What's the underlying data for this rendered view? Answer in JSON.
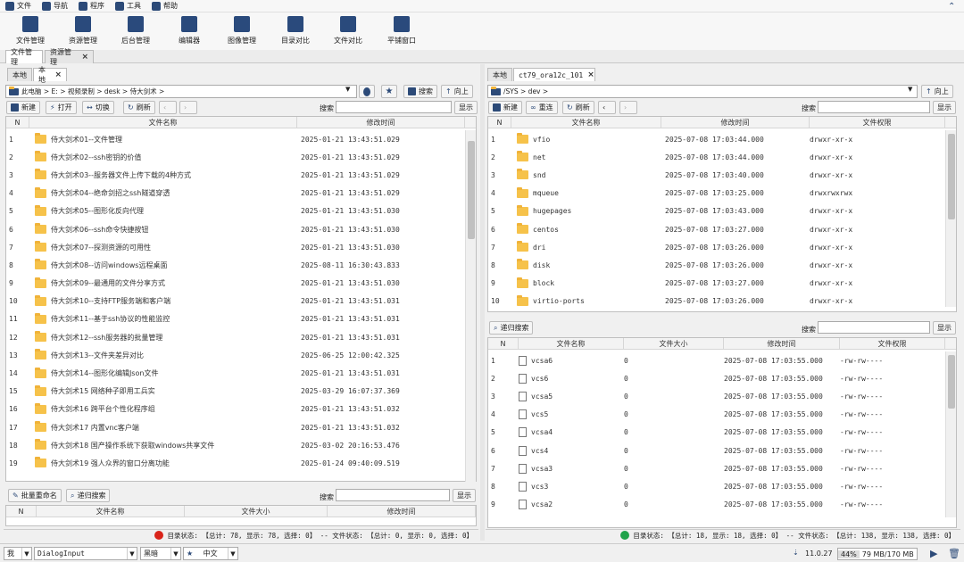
{
  "menu": [
    {
      "label": "文件",
      "icon": "file-icon"
    },
    {
      "label": "导航",
      "icon": "menu-icon"
    },
    {
      "label": "程序",
      "icon": "keyboard-icon"
    },
    {
      "label": "工具",
      "icon": "toolbox-icon"
    },
    {
      "label": "帮助",
      "icon": "help-icon"
    }
  ],
  "tools": [
    "文件管理",
    "资源管理",
    "后台管理",
    "编辑器",
    "图像管理",
    "目录对比",
    "文件对比",
    "平铺窗口"
  ],
  "main_tabs": [
    "文件管理",
    "资源管理"
  ],
  "left": {
    "tabs": [
      "本地",
      "本地"
    ],
    "path": "此电脑 > E: > 视频录制 > desk > 侍大剑术 >",
    "search_btn": "搜索",
    "up_btn": "向上",
    "new_btn": "新建",
    "open_btn": "打开",
    "switch_btn": "切换",
    "refresh_btn": "刷新",
    "search_label": "搜索",
    "show_btn": "显示",
    "cols": [
      "文件名称",
      "修改时间"
    ],
    "rows": [
      [
        "1",
        "侍大剑术01--文件管理",
        "2025-01-21 13:43:51.029"
      ],
      [
        "2",
        "侍大剑术02--ssh密钥的价值",
        "2025-01-21 13:43:51.029"
      ],
      [
        "3",
        "侍大剑术03--服务器文件上传下载的4种方式",
        "2025-01-21 13:43:51.029"
      ],
      [
        "4",
        "侍大剑术04--绝命剑招之ssh隧道穿透",
        "2025-01-21 13:43:51.029"
      ],
      [
        "5",
        "侍大剑术05--图形化反向代理",
        "2025-01-21 13:43:51.030"
      ],
      [
        "6",
        "侍大剑术06--ssh命令快捷按钮",
        "2025-01-21 13:43:51.030"
      ],
      [
        "7",
        "侍大剑术07--探测资源的可用性",
        "2025-01-21 13:43:51.030"
      ],
      [
        "8",
        "侍大剑术08--访问windows远程桌面",
        "2025-08-11 16:30:43.833"
      ],
      [
        "9",
        "侍大剑术09--最通用的文件分享方式",
        "2025-01-21 13:43:51.030"
      ],
      [
        "10",
        "侍大剑术10--支持FTP服务端和客户端",
        "2025-01-21 13:43:51.031"
      ],
      [
        "11",
        "侍大剑术11--基于ssh协议的性能监控",
        "2025-01-21 13:43:51.031"
      ],
      [
        "12",
        "侍大剑术12--ssh服务器的批量管理",
        "2025-01-21 13:43:51.031"
      ],
      [
        "13",
        "侍大剑术13--文件夹差异对比",
        "2025-06-25 12:00:42.325"
      ],
      [
        "14",
        "侍大剑术14--图形化编辑Json文件",
        "2025-01-21 13:43:51.031"
      ],
      [
        "15",
        "侍大剑术15  网络种子即用工兵实",
        "2025-03-29 16:07:37.369"
      ],
      [
        "16",
        "侍大剑术16  跨平台个性化程序组",
        "2025-01-21 13:43:51.032"
      ],
      [
        "17",
        "侍大剑术17  内置vnc客户端",
        "2025-01-21 13:43:51.032"
      ],
      [
        "18",
        "侍大剑术18  国产操作系统下获取windows共享文件",
        "2025-03-02 20:16:53.476"
      ],
      [
        "19",
        "侍大剑术19  强人众界的窗口分离功能",
        "2025-01-24 09:40:09.519"
      ]
    ],
    "batch_btn": "批量重命名",
    "recursive_btn": "递归搜索",
    "search_label2": "搜索",
    "show_btn2": "显示",
    "cols2": [
      "文件名称",
      "文件大小",
      "修改时间"
    ],
    "status_text": "目录状态: 【总计: 78, 显示: 78, 选择: 0】 -- 文件状态: 【总计: 0, 显示: 0, 选择: 0】"
  },
  "right": {
    "tabs": [
      "本地",
      "ct79_ora12c_101"
    ],
    "path": "/SYS > dev >",
    "up_btn": "向上",
    "new_btn": "新建",
    "remote_btn": "重连",
    "refresh_btn": "刷新",
    "search_label": "搜索",
    "show_btn": "显示",
    "cols": [
      "文件名称",
      "修改时间",
      "文件权限"
    ],
    "rows": [
      [
        "1",
        "vfio",
        "2025-07-08 17:03:44.000",
        "drwxr-xr-x"
      ],
      [
        "2",
        "net",
        "2025-07-08 17:03:44.000",
        "drwxr-xr-x"
      ],
      [
        "3",
        "snd",
        "2025-07-08 17:03:40.000",
        "drwxr-xr-x"
      ],
      [
        "4",
        "mqueue",
        "2025-07-08 17:03:25.000",
        "drwxrwxrwx"
      ],
      [
        "5",
        "hugepages",
        "2025-07-08 17:03:43.000",
        "drwxr-xr-x"
      ],
      [
        "6",
        "centos",
        "2025-07-08 17:03:27.000",
        "drwxr-xr-x"
      ],
      [
        "7",
        "dri",
        "2025-07-08 17:03:26.000",
        "drwxr-xr-x"
      ],
      [
        "8",
        "disk",
        "2025-07-08 17:03:26.000",
        "drwxr-xr-x"
      ],
      [
        "9",
        "block",
        "2025-07-08 17:03:27.000",
        "drwxr-xr-x"
      ],
      [
        "10",
        "virtio-ports",
        "2025-07-08 17:03:26.000",
        "drwxr-xr-x"
      ]
    ],
    "recursive_btn": "递归搜索",
    "search_label2": "搜索",
    "show_btn2": "显示",
    "cols2": [
      "N",
      "文件名称",
      "文件大小",
      "修改时间",
      "文件权限"
    ],
    "rows2": [
      [
        "1",
        "vcsa6",
        "0",
        "2025-07-08 17:03:55.000",
        "-rw-rw----"
      ],
      [
        "2",
        "vcs6",
        "0",
        "2025-07-08 17:03:55.000",
        "-rw-rw----"
      ],
      [
        "3",
        "vcsa5",
        "0",
        "2025-07-08 17:03:55.000",
        "-rw-rw----"
      ],
      [
        "4",
        "vcs5",
        "0",
        "2025-07-08 17:03:55.000",
        "-rw-rw----"
      ],
      [
        "5",
        "vcsa4",
        "0",
        "2025-07-08 17:03:55.000",
        "-rw-rw----"
      ],
      [
        "6",
        "vcs4",
        "0",
        "2025-07-08 17:03:55.000",
        "-rw-rw----"
      ],
      [
        "7",
        "vcsa3",
        "0",
        "2025-07-08 17:03:55.000",
        "-rw-rw----"
      ],
      [
        "8",
        "vcs3",
        "0",
        "2025-07-08 17:03:55.000",
        "-rw-rw----"
      ],
      [
        "9",
        "vcsa2",
        "0",
        "2025-07-08 17:03:55.000",
        "-rw-rw----"
      ]
    ],
    "status_text": "目录状态: 【总计: 18, 显示: 18, 选择: 0】 -- 文件状态: 【总计: 138, 显示: 138, 选择: 0】"
  },
  "bottom": {
    "input_value": "DialogInput",
    "sel1": "我",
    "sel2": "黑暗",
    "sel3": "中文",
    "version": "11.0.27",
    "cpu": "44%",
    "mem": "79 MB/170 MB"
  },
  "colors": {
    "accent": "#2c4a78",
    "red_status": "#d9241a",
    "green_status": "#1fa34a"
  }
}
